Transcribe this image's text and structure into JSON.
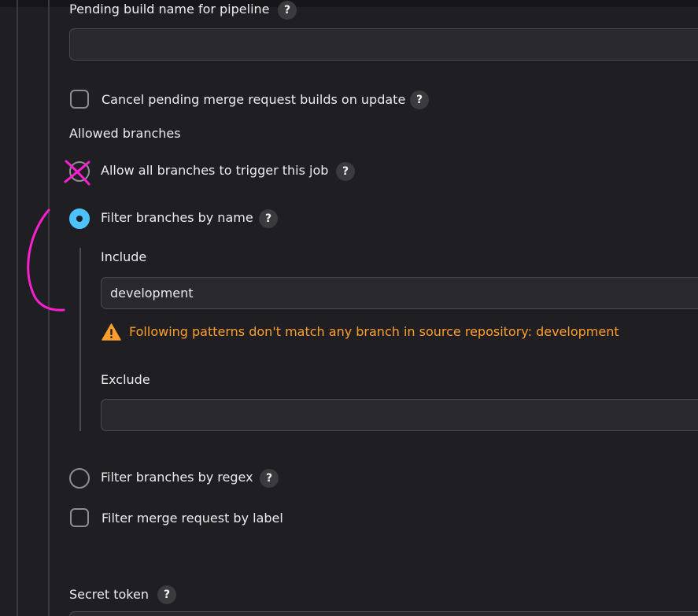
{
  "pending_build_name": {
    "label": "Pending build name for pipeline",
    "help": "?",
    "value": ""
  },
  "cancel_pending": {
    "label": "Cancel pending merge request builds on update",
    "help": "?",
    "checked": false
  },
  "allowed_branches": {
    "heading": "Allowed branches",
    "options": [
      {
        "label": "Allow all branches to trigger this job",
        "help": "?",
        "selected": false
      },
      {
        "label": "Filter branches by name",
        "help": "?",
        "selected": true
      },
      {
        "label": "Filter branches by regex",
        "help": "?",
        "selected": false
      }
    ],
    "include": {
      "label": "Include",
      "value": "development",
      "warning": "Following patterns don't match any branch in source repository: development"
    },
    "exclude": {
      "label": "Exclude",
      "value": ""
    }
  },
  "filter_by_label": {
    "label": "Filter merge request by label",
    "checked": false
  },
  "secret_token": {
    "label": "Secret token",
    "help": "?"
  },
  "colors": {
    "background": "#1f1f23",
    "accent": "#4cc2ff",
    "warning": "#ff9e2c",
    "annotation": "#ff1fd2"
  },
  "icons": {
    "warning": "warning-triangle-icon",
    "help": "question-mark-icon"
  }
}
